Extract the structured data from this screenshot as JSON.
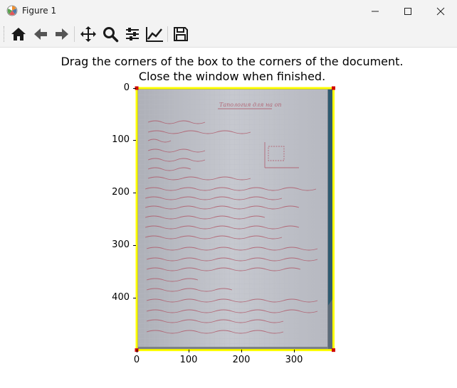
{
  "window": {
    "title": "Figure 1",
    "icon": "matplotlib-logo-icon",
    "controls": [
      "minimize-icon",
      "maximize-icon",
      "close-icon"
    ]
  },
  "toolbar": {
    "buttons": [
      "home-icon",
      "back-arrow-icon",
      "forward-arrow-icon",
      "pan-move-icon",
      "zoom-magnifier-icon",
      "configure-subplots-icon",
      "edit-axis-line-icon",
      "save-floppy-icon"
    ]
  },
  "plot": {
    "title_line1": "Drag the corners of the box to the corners of the document.",
    "title_line2": "Close the window when finished.",
    "xticks": [
      "0",
      "100",
      "200",
      "300"
    ],
    "yticks": [
      "0",
      "100",
      "200",
      "300",
      "400"
    ],
    "box_color": "#ffff00",
    "corner_color": "#d00000",
    "x_range": [
      0,
      375
    ],
    "y_range": [
      0,
      500
    ],
    "box_corners": [
      [
        0,
        0
      ],
      [
        375,
        0
      ],
      [
        375,
        500
      ],
      [
        0,
        500
      ]
    ]
  },
  "document_text": {
    "heading": "Тапология для на оп"
  }
}
